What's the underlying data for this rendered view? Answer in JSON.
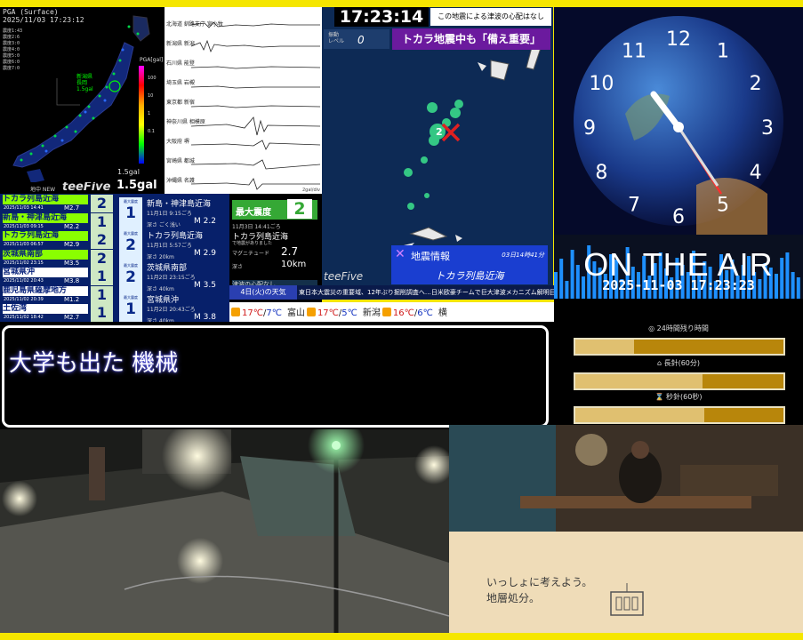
{
  "seismic": {
    "header_line1": "PGA (Surface)",
    "header_line2": "2025/11/03 17:23:12",
    "stats": [
      "震度1:43",
      "震度2:6",
      "震度3:0",
      "震度4:0",
      "震度5:0",
      "震度6:0",
      "震度7:0"
    ],
    "pga_label": "PGA[gal]",
    "scale_ticks": [
      "100",
      "10",
      "1",
      "0.1"
    ],
    "near_label_1": "新潟県",
    "near_label_2": "長岡",
    "near_label_3": "1.5gal",
    "gal_small": "1.5gal",
    "gal_big": "1.5gal"
  },
  "waveform": {
    "stations": [
      "北海道 釧路支庁 宮小牧",
      "新潟県 新潟",
      "石川県 能登",
      "埼玉県 岩槻",
      "東京都 新宿",
      "神奈川県 相模原",
      "大阪府 堺",
      "宮崎県 都城",
      "沖縄県 名護"
    ],
    "footer": "2gal/div"
  },
  "quake_list": {
    "top_label": "地中 NEW",
    "logo": "teeFive",
    "rows": [
      {
        "name": "トカラ列島近海",
        "date": "2025/11/03 14:41",
        "mag": "M2.7",
        "shindo": "2",
        "color": "#8aff00"
      },
      {
        "name": "新島・神津島近海",
        "date": "2025/11/03 09:15",
        "mag": "M2.2",
        "shindo": "1",
        "color": "#8aff00"
      },
      {
        "name": "トカラ列島近海",
        "date": "2025/11/03 06:57",
        "mag": "M2.9",
        "shindo": "2",
        "color": "#8aff00"
      },
      {
        "name": "茨城県南部",
        "date": "2025/11/02 23:15",
        "mag": "M3.5",
        "shindo": "2",
        "color": "#8aff00"
      },
      {
        "name": "宮城県沖",
        "date": "2025/11/02 20:43",
        "mag": "M3.8",
        "shindo": "1",
        "color": "#ffffff"
      },
      {
        "name": "鹿児島県薩摩地方",
        "date": "2025/11/02 20:39",
        "mag": "M1.2",
        "shindo": "1",
        "color": "#ffffff"
      },
      {
        "name": "土佐湾",
        "date": "2025/11/02 18:42",
        "mag": "M2.7",
        "shindo": "1",
        "color": "#ffffff"
      }
    ]
  },
  "quake_info": {
    "rows": [
      {
        "label": "最大震度",
        "shindo": "1",
        "name": "新島・神津島近海",
        "date": "11月1日 9:15ごろ",
        "depth": "深さ ごく浅い",
        "mag": "M 2.2"
      },
      {
        "label": "最大震度",
        "shindo": "2",
        "name": "トカラ列島近海",
        "date": "11月1日 5:57ごろ",
        "depth": "深さ 20km",
        "mag": "M 2.9"
      },
      {
        "label": "最大震度",
        "shindo": "2",
        "name": "茨城県南部",
        "date": "11月2日 23:15ごろ",
        "depth": "深さ 40km",
        "mag": "M 3.5"
      },
      {
        "label": "最大震度",
        "shindo": "1",
        "name": "宮城県沖",
        "date": "11月2日 20:43ごろ",
        "depth": "深さ 40km",
        "mag": "M 3.8"
      }
    ]
  },
  "max_intensity": {
    "label": "最大震度",
    "value": "2",
    "date": "11月3日 14:41ごろ",
    "name": "トカラ列島近海",
    "tsunami": "で地震がありました",
    "mag_label": "マグニチュード",
    "mag_value": "2.7",
    "depth_label": "深さ",
    "depth_value": "10km",
    "tsunami_note": "津波の心配なし"
  },
  "ticker": {
    "day": "4日(火)の天気",
    "news": "東日本大震災の重要域、12年ぶり掘削調査へ…日米欧豪チームで巨大津波メカニズム解明目指す"
  },
  "weather": {
    "items": [
      {
        "city": "",
        "hi": "17℃",
        "lo": "7℃"
      },
      {
        "city": "富山",
        "hi": "17℃",
        "lo": "5℃"
      },
      {
        "city": "新潟",
        "hi": "16℃",
        "lo": "6℃"
      },
      {
        "city": "横",
        "hi": "",
        "lo": ""
      }
    ]
  },
  "tokara_map": {
    "clock": "17:23:14",
    "tsunami": "この地震による津波の心配はなし",
    "level_label_1": "振動",
    "level_label_2": "レベル",
    "level_value": "0",
    "alert": "トカラ地震中も「備え重要」",
    "info_title": "地震情報",
    "info_time": "03日14時41分",
    "info_location": "トカラ列島近海",
    "logo": "teeFive",
    "epicenter_label": "2"
  },
  "clock_panel": {
    "numbers": [
      "12",
      "1",
      "2",
      "3",
      "4",
      "5",
      "6",
      "7",
      "8",
      "9",
      "10",
      "11"
    ]
  },
  "on_air": {
    "text": "ON THE AIR",
    "timestamp": "2025-11-03 17:23:23"
  },
  "remaining": {
    "day_label": "◎ 24時間残り時間",
    "minute_label": "⌂ 長針(60分)",
    "second_label": "⌛ 秒針(60秒)",
    "day_progress": 0.28,
    "minute_progress": 0.61,
    "second_progress": 0.62
  },
  "subtitle": {
    "text": "大学も出た 機械"
  },
  "ad": {
    "line1": "いっしょに考えよう。",
    "line2": "地層処分。"
  }
}
